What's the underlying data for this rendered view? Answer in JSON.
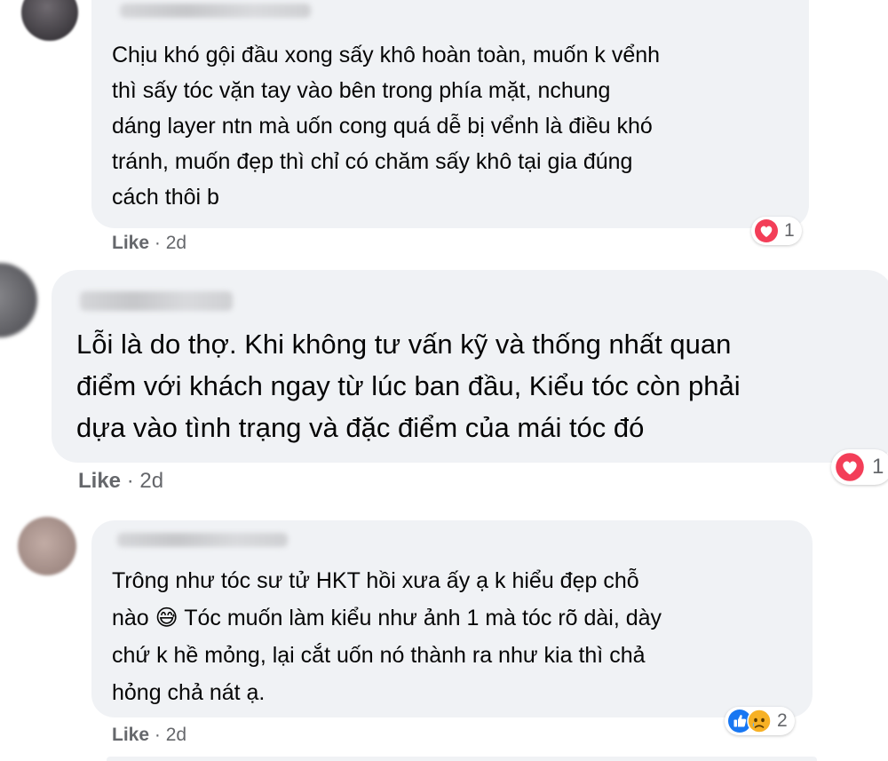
{
  "comments": [
    {
      "author": "",
      "lines": [
        "Chịu khó gội đầu xong sấy khô hoàn toàn, muốn k vểnh",
        "thì sấy tóc vặn tay vào bên trong phía mặt, nchung",
        "dáng layer ntn mà uốn cong quá dễ bị vểnh là điều khó",
        "tránh, muốn đẹp thì chỉ có chăm sấy khô tại gia đúng",
        "cách thôi b"
      ],
      "like_label": "Like",
      "separator": "·",
      "time": "2d",
      "reactions": {
        "icons": [
          "heart-icon"
        ],
        "count": "1"
      }
    },
    {
      "author": "",
      "lines": [
        "Lỗi là do thợ. Khi không tư vấn kỹ và thống nhất quan",
        "điểm với khách ngay từ lúc ban đầu, Kiểu tóc còn phải",
        "dựa vào tình trạng và đặc điểm của mái tóc đó"
      ],
      "like_label": "Like",
      "separator": "·",
      "time": "2d",
      "reactions": {
        "icons": [
          "heart-icon"
        ],
        "count": "1"
      }
    },
    {
      "author": "",
      "lines": [
        "Trông như tóc sư tử HKT hồi xưa ấy ạ k hiểu đẹp chỗ",
        "nào 😅 Tóc muốn làm kiểu như ảnh 1 mà tóc rõ dài, dày",
        "chứ k hề mỏng, lại cắt uốn nó thành ra như kia thì chả",
        "hỏng chả nát ạ."
      ],
      "like_label": "Like",
      "separator": "·",
      "time": "2d",
      "reactions": {
        "icons": [
          "like-icon",
          "sad-icon"
        ],
        "count": "2"
      }
    }
  ],
  "colors": {
    "bubble": "#f0f2f5",
    "meta_text": "#65676b",
    "heart": "#f33e58",
    "like_blue": "#1877f2",
    "sad_yellow": "#f7b125"
  }
}
